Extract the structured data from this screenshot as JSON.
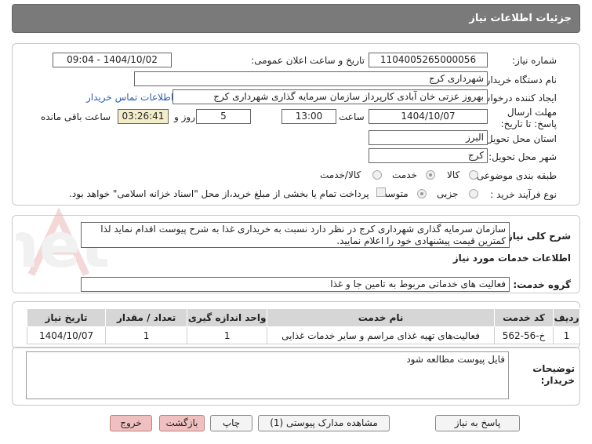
{
  "header": {
    "title": "جزئیات اطلاعات نیاز"
  },
  "form": {
    "need_number_label": "شماره نیاز:",
    "need_number": "1104005265000056",
    "announce_label": "تاریخ و ساعت اعلان عمومی:",
    "announce_value": "1404/10/02 - 09:04",
    "buyer_org_label": "نام دستگاه خریدار:",
    "buyer_org": "شهرداری کرج",
    "creator_label": "ایجاد کننده درخواست:",
    "creator": "بهروز عزتی خان آبادی کارپرداز سازمان سرمایه گذاری شهرداری کرج",
    "contact_link": "اطلاعات تماس خریدار",
    "deadline_label": "مهلت ارسال پاسخ: تا تاریخ:",
    "deadline_date": "1404/10/07",
    "time_label": "ساعت",
    "deadline_time": "13:00",
    "days_value": "5",
    "days_label": "روز و",
    "remaining_time": "03:26:41",
    "remaining_label": "ساعت باقی مانده",
    "province_label": "استان محل تحویل:",
    "province": "البرز",
    "city_label": "شهر محل تحویل:",
    "city": "کرج",
    "category_label": "طبقه بندی موضوعی:",
    "category_options": [
      "کالا",
      "خدمت",
      "کالا/خدمت"
    ],
    "category_selected": "خدمت",
    "process_label": "نوع فرآیند خرید :",
    "process_options": [
      "جزیی",
      "متوسط"
    ],
    "process_selected": "متوسط",
    "payment_note": "پرداخت تمام یا بخشی از مبلغ خرید،از محل \"اسناد خزانه اسلامی\" خواهد بود."
  },
  "summary": {
    "label": "شرح کلی نیاز:",
    "text": "سازمان سرمایه گذاری  شهرداری کرج در نظر دارد نسبت به خریداری غذا به شرح پیوست اقدام نماید لذا کمترین قیمت پیشنهادی خود را اعلام نمایید."
  },
  "services": {
    "section_title": "اطلاعات خدمات مورد نیاز",
    "group_label": "گروه خدمت:",
    "group_value": "فعالیت های خدماتی مربوط به تامین جا و غذا",
    "columns": [
      "ردیف",
      "کد خدمت",
      "نام خدمت",
      "واحد اندازه گیری",
      "تعداد / مقدار",
      "تاریخ نیاز"
    ],
    "rows": [
      [
        "1",
        "خ-56-562",
        "فعالیت‌های تهیه غذای مراسم و سایر خدمات غذایی",
        "1",
        "1",
        "1404/10/07"
      ]
    ]
  },
  "buyer_notes": {
    "label": "توضیحات خریدار:",
    "text": "فایل پیوست مطالعه شود"
  },
  "buttons": {
    "reply": "پاسخ به نیاز",
    "attachments": "مشاهده مدارک پیوستی (1)",
    "print": "چاپ",
    "back": "بازگشت",
    "exit": "خروج"
  },
  "watermark": {
    "text": "AriaTender.net"
  },
  "colors": {
    "header_bg": "#7a7a7a",
    "remaining_bg": "#f3eec9",
    "link": "#2a5db0",
    "red_button": "#f0c0c0"
  }
}
